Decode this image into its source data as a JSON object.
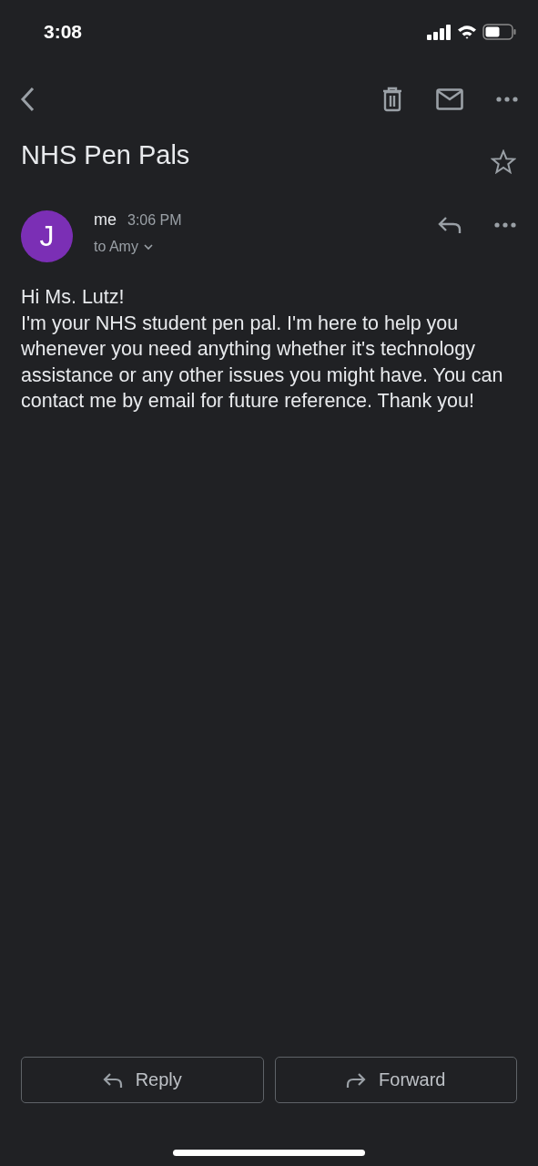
{
  "status_bar": {
    "time": "3:08"
  },
  "subject": {
    "title": "NHS Pen Pals",
    "starred": false
  },
  "message": {
    "avatar_letter": "J",
    "sender": "me",
    "time": "3:06 PM",
    "recipient": "to Amy"
  },
  "body": {
    "greeting": "Hi Ms. Lutz!",
    "text": "I'm your NHS student pen pal. I'm here to help you whenever you need anything whether it's technology assistance or any other issues you might have. You can contact me by email for future reference. Thank you!"
  },
  "buttons": [
    {
      "kind": "reply",
      "label": "Reply"
    },
    {
      "kind": "forward",
      "label": "Forward"
    }
  ]
}
